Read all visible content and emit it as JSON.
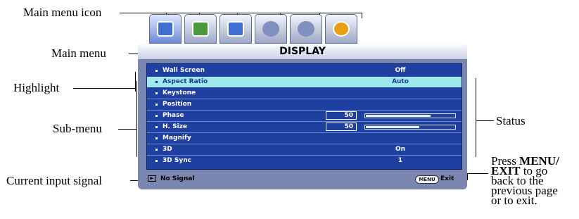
{
  "callouts": {
    "main_menu_icon": "Main menu icon",
    "main_menu": "Main menu",
    "highlight": "Highlight",
    "sub_menu": "Sub-menu",
    "current_input_signal": "Current input signal",
    "status": "Status",
    "press_line1_prefix": "Press ",
    "press_line1_bold": "MENU/",
    "press_line2_bold": "EXIT",
    "press_line2_rest": " to go",
    "press_line3": "back to the",
    "press_line4": "previous page",
    "press_line5": "or to exit."
  },
  "tabs": [
    {
      "icon": "display-icon",
      "color": "#3f6fd0"
    },
    {
      "icon": "picture-icon",
      "color": "#4a9a3c"
    },
    {
      "icon": "source-icon",
      "color": "#3f6fd0"
    },
    {
      "icon": "system-setup-basic-icon",
      "color": "#8090c0"
    },
    {
      "icon": "system-setup-advanced-icon",
      "color": "#8090c0"
    },
    {
      "icon": "information-icon",
      "color": "#e8a010"
    }
  ],
  "menu": {
    "title": "DISPLAY",
    "items": [
      {
        "name": "Wall Screen",
        "value": "Off"
      },
      {
        "name": "Aspect Ratio",
        "value": "Auto"
      },
      {
        "name": "Keystone",
        "value": ""
      },
      {
        "name": "Position",
        "value": ""
      },
      {
        "name": "Phase",
        "number": "50",
        "level": 0.73
      },
      {
        "name": "H. Size",
        "number": "50",
        "level": 0.6
      },
      {
        "name": "Magnify",
        "value": ""
      },
      {
        "name": "3D",
        "value": "On"
      },
      {
        "name": "3D Sync",
        "value": "1"
      }
    ],
    "status_signal": "No Signal",
    "exit_key": "MENU",
    "exit_label": "Exit"
  },
  "colors": {
    "menu_frame": "#7c87b1",
    "menu_body": "#1f40a0",
    "highlight_row": "#9fe9ee"
  }
}
